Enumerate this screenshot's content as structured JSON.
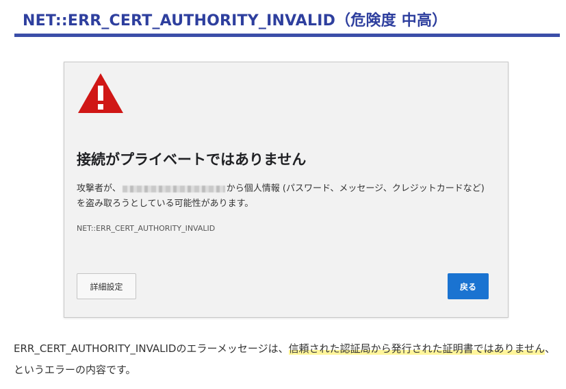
{
  "heading": {
    "title": "NET::ERR_CERT_AUTHORITY_INVALID（危険度 中高）"
  },
  "error_page": {
    "icon": "warning-triangle-icon",
    "title": "接続がプライベートではありません",
    "body_prefix": "攻撃者が、",
    "body_suffix": "から個人情報 (パスワード、メッセージ、クレジットカードなど) を盗み取ろうとしている可能性があります。",
    "error_code": "NET::ERR_CERT_AUTHORITY_INVALID",
    "advanced_button": "詳細設定",
    "back_button": "戻る"
  },
  "description": {
    "prefix": "ERR_CERT_AUTHORITY_INVALIDのエラーメッセージは、",
    "highlight": "信頼された認証局から発行された証明書ではありません",
    "suffix": "、というエラーの内容です。"
  },
  "colors": {
    "heading_text": "#2e3f9e",
    "heading_rule": "#3b4ea8",
    "warning_red": "#d01716",
    "back_button": "#1a73d1",
    "highlight": "#fff59a"
  }
}
